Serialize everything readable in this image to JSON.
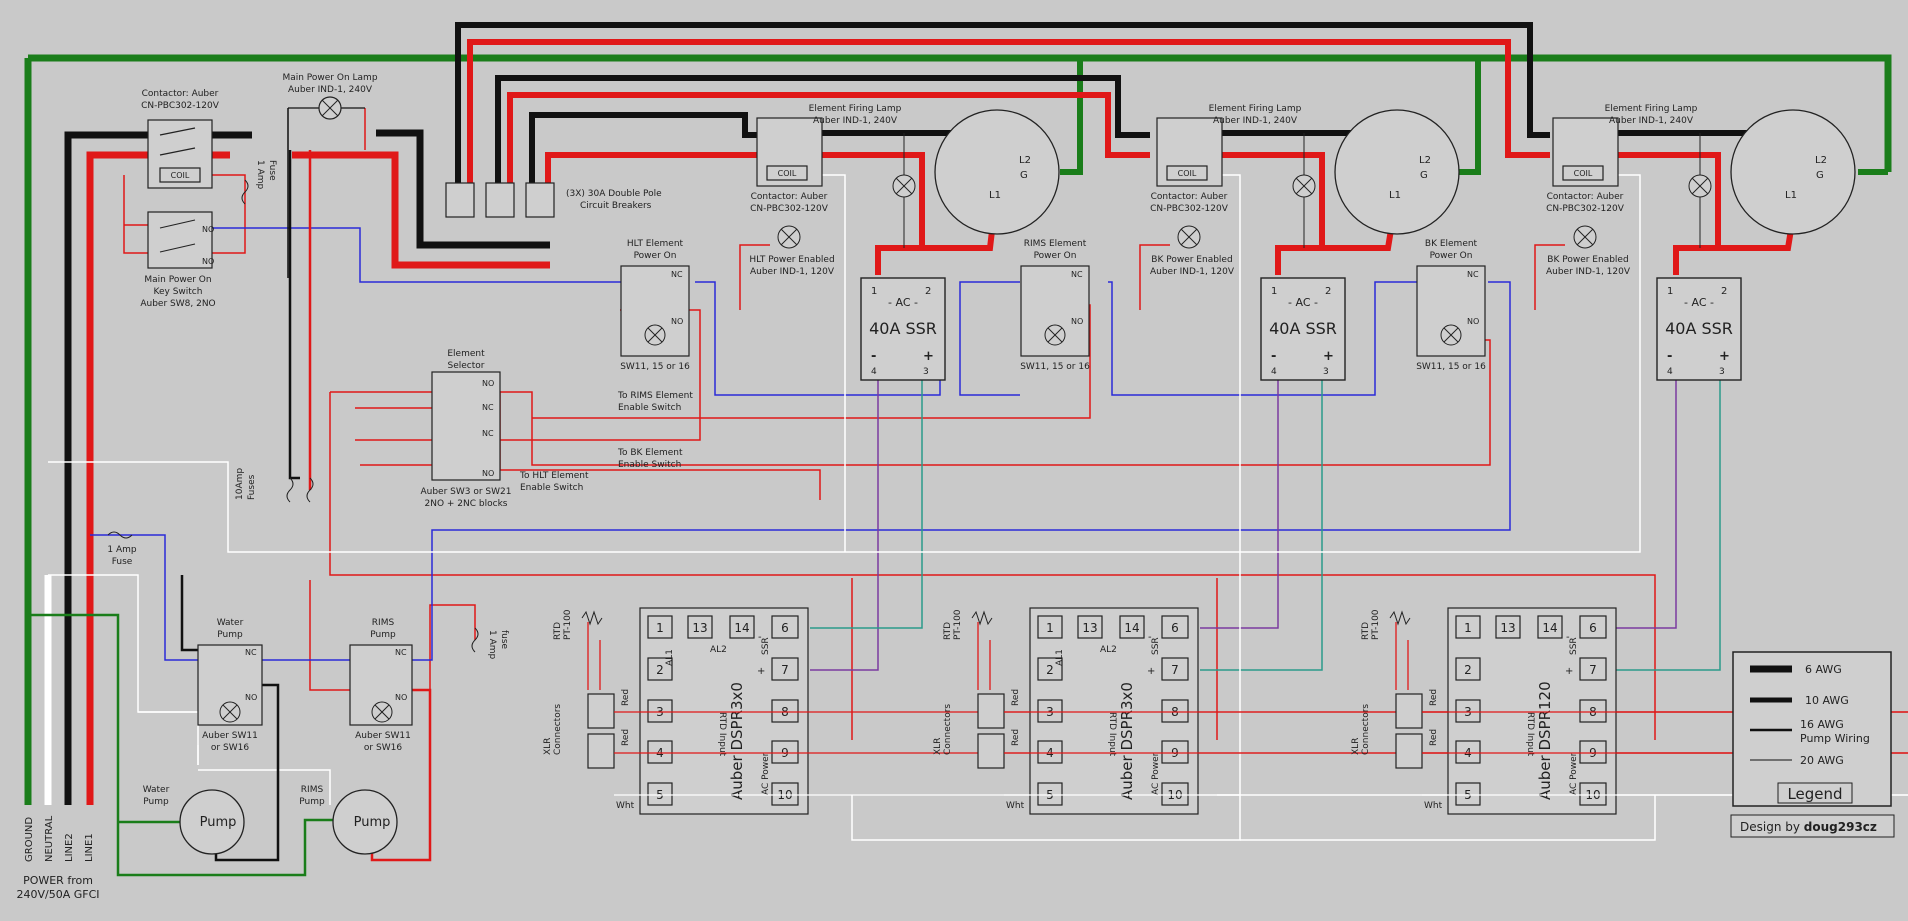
{
  "power": {
    "label_line1": "POWER from",
    "label_line2": "240V/50A GFCI",
    "conductors": [
      "GROUND",
      "NEUTRAL",
      "LINE2",
      "LINE1"
    ]
  },
  "main": {
    "contactor_line1": "Contactor: Auber",
    "contactor_line2": "CN-PBC302-120V",
    "coil": "COIL",
    "lamp_line1": "Main Power On Lamp",
    "lamp_line2": "Auber IND-1, 240V",
    "fuse_1a_line1": "1 Amp",
    "fuse_1a_line2": "Fuse",
    "keyswitch_line1": "Main Power On",
    "keyswitch_line2": "Key Switch",
    "keyswitch_line3": "Auber SW8, 2NO",
    "no": "NO",
    "nc": "NC",
    "breakers_line1": "(3X) 30A Double Pole",
    "breakers_line2": "Circuit Breakers"
  },
  "selector": {
    "title_line1": "Element",
    "title_line2": "Selector",
    "part_line1": "Auber SW3 or SW21",
    "part_line2": "2NO + 2NC blocks",
    "to_hlt_line1": "To HLT Element",
    "to_hlt_line2": "Enable Switch",
    "to_rims_line1": "To RIMS Element",
    "to_rims_line2": "Enable Switch",
    "to_bk_line1": "To BK Element",
    "to_bk_line2": "Enable Switch"
  },
  "fuses": {
    "fuse_10a_line1": "10Amp",
    "fuse_10a_line2": "Fuses",
    "fuse_1a_left_line1": "1 Amp",
    "fuse_1a_left_line2": "Fuse",
    "fuse_1a_rims_line1": "1 Amp",
    "fuse_1a_rims_line2": "fuse"
  },
  "pumps": {
    "water_switch_line1": "Water",
    "water_switch_line2": "Pump",
    "water_switch_part_line1": "Auber SW11",
    "water_switch_part_line2": "or SW16",
    "rims_switch_line1": "RIMS",
    "rims_switch_line2": "Pump",
    "rims_switch_part_line1": "Auber SW11",
    "rims_switch_part_line2": "or SW16",
    "water_pump_line1": "Water",
    "water_pump_line2": "Pump",
    "rims_pump_line1": "RIMS",
    "rims_pump_line2": "Pump",
    "pump_text": "Pump"
  },
  "elements": [
    {
      "firing_lamp_line1": "Element Firing Lamp",
      "firing_lamp_line2": "Auber IND-1, 240V",
      "contactor_line1": "Contactor: Auber",
      "contactor_line2": "CN-PBC302-120V",
      "enabled_line1": "HLT Power Enabled",
      "enabled_line2": "Auber IND-1, 120V",
      "power_on_line1": "HLT Element",
      "power_on_line2": "Power On",
      "switch_part": "SW11, 15 or 16",
      "ssr_title": "40A SSR",
      "ssr_ac": "- AC -",
      "l1": "L1",
      "l2": "L2",
      "g": "G"
    },
    {
      "firing_lamp_line1": "Element Firing Lamp",
      "firing_lamp_line2": "Auber IND-1, 240V",
      "contactor_line1": "Contactor: Auber",
      "contactor_line2": "CN-PBC302-120V",
      "enabled_line1": "BK Power Enabled",
      "enabled_line2": "Auber IND-1, 120V",
      "power_on_line1": "RIMS Element",
      "power_on_line2": "Power On",
      "switch_part": "SW11, 15 or 16",
      "ssr_title": "40A SSR",
      "ssr_ac": "- AC -",
      "l1": "L1",
      "l2": "L2",
      "g": "G"
    },
    {
      "firing_lamp_line1": "Element Firing Lamp",
      "firing_lamp_line2": "Auber IND-1, 240V",
      "contactor_line1": "Contactor: Auber",
      "contactor_line2": "CN-PBC302-120V",
      "enabled_line1": "BK Power Enabled",
      "enabled_line2": "Auber IND-1, 120V",
      "power_on_line1": "BK Element",
      "power_on_line2": "Power On",
      "switch_part": "SW11, 15 or 16",
      "ssr_title": "40A SSR",
      "ssr_ac": "- AC -",
      "l1": "L1",
      "l2": "L2",
      "g": "G"
    }
  ],
  "controllers": [
    {
      "model": "Auber DSPR3x0",
      "ac_power": "AC Power",
      "ssr": "SSR",
      "al1": "AL1",
      "al2": "AL2",
      "rtd_input": "RTD Input",
      "rtd_line1": "RTD",
      "rtd_line2": "PT-100",
      "xlr_line1": "XLR",
      "xlr_line2": "Connectors",
      "red": "Red",
      "wht": "Wht",
      "terminals": [
        "1",
        "2",
        "3",
        "4",
        "5",
        "13",
        "14",
        "6",
        "7",
        "8",
        "9",
        "10"
      ]
    },
    {
      "model": "Auber DSPR3x0",
      "ac_power": "AC Power",
      "ssr": "SSR",
      "al1": "AL1",
      "al2": "AL2",
      "rtd_input": "RTD Input",
      "rtd_line1": "RTD",
      "rtd_line2": "PT-100",
      "xlr_line1": "XLR",
      "xlr_line2": "Connectors",
      "red": "Red",
      "wht": "Wht",
      "terminals": [
        "1",
        "2",
        "3",
        "4",
        "5",
        "13",
        "14",
        "6",
        "7",
        "8",
        "9",
        "10"
      ]
    },
    {
      "model": "Auber DSPR120",
      "ac_power": "AC Power",
      "ssr": "SSR",
      "al1": "",
      "al2": "",
      "rtd_input": "RTD Input",
      "rtd_line1": "RTD",
      "rtd_line2": "PT-100",
      "xlr_line1": "XLR",
      "xlr_line2": "Connectors",
      "red": "Red",
      "wht": "Wht",
      "terminals": [
        "1",
        "2",
        "3",
        "4",
        "5",
        "13",
        "14",
        "6",
        "7",
        "8",
        "9",
        "10"
      ]
    }
  ],
  "legend": {
    "awg6": "6 AWG",
    "awg10": "10 AWG",
    "awg16_line1": "16 AWG",
    "awg16_line2": "Pump Wiring",
    "awg20": "20 AWG",
    "title": "Legend"
  },
  "credit": {
    "prefix": "Design by ",
    "author": "doug293cz"
  },
  "colors": {
    "background": "#c9c9c9",
    "ground": "#1a7d1a",
    "neutral": "#ffffff",
    "line1": "#e01818",
    "line2": "#111111",
    "control_blue": "#2a2ad8",
    "ssr_purple": "#7a3aa0",
    "ssr_teal": "#2a9a8a"
  }
}
